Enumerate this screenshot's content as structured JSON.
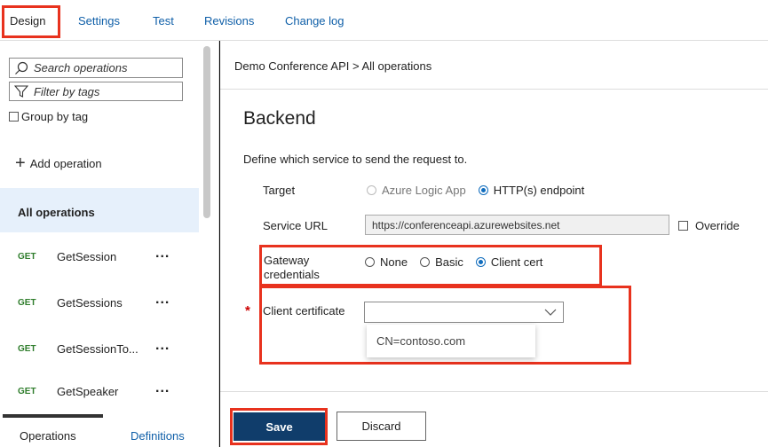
{
  "tabs": [
    {
      "label": "Design",
      "active": true
    },
    {
      "label": "Settings"
    },
    {
      "label": "Test"
    },
    {
      "label": "Revisions"
    },
    {
      "label": "Change log"
    }
  ],
  "sidebar": {
    "search_placeholder": "Search operations",
    "filter_placeholder": "Filter by tags",
    "group_by_tag": "Group by tag",
    "add_operation": "Add operation",
    "all_operations": "All operations",
    "operations": [
      {
        "method": "GET",
        "name": "GetSession"
      },
      {
        "method": "GET",
        "name": "GetSessions"
      },
      {
        "method": "GET",
        "name": "GetSessionTo..."
      },
      {
        "method": "GET",
        "name": "GetSpeaker"
      }
    ],
    "more_label": "...",
    "bottom_tabs": [
      "Operations",
      "Definitions"
    ]
  },
  "main": {
    "breadcrumb": "Demo Conference API > All operations",
    "title": "Backend",
    "description": "Define which service to send the request to.",
    "target": {
      "label": "Target",
      "options": [
        "Azure Logic App",
        "HTTP(s) endpoint"
      ],
      "selected": "HTTP(s) endpoint"
    },
    "service_url": {
      "label": "Service URL",
      "value": "https://conferenceapi.azurewebsites.net",
      "override_label": "Override"
    },
    "gateway_credentials": {
      "label_line1": "Gateway",
      "label_line2": "credentials",
      "options": [
        "None",
        "Basic",
        "Client cert"
      ],
      "selected": "Client cert"
    },
    "client_certificate": {
      "required_mark": "*",
      "label": "Client certificate",
      "value": "",
      "dropdown_option": "CN=contoso.com"
    },
    "save_label": "Save",
    "discard_label": "Discard"
  },
  "colors": {
    "accent": "#0f5fa8",
    "highlight": "#e8321e",
    "save_bg": "#103d6b",
    "get_method": "#2f7d2c"
  }
}
